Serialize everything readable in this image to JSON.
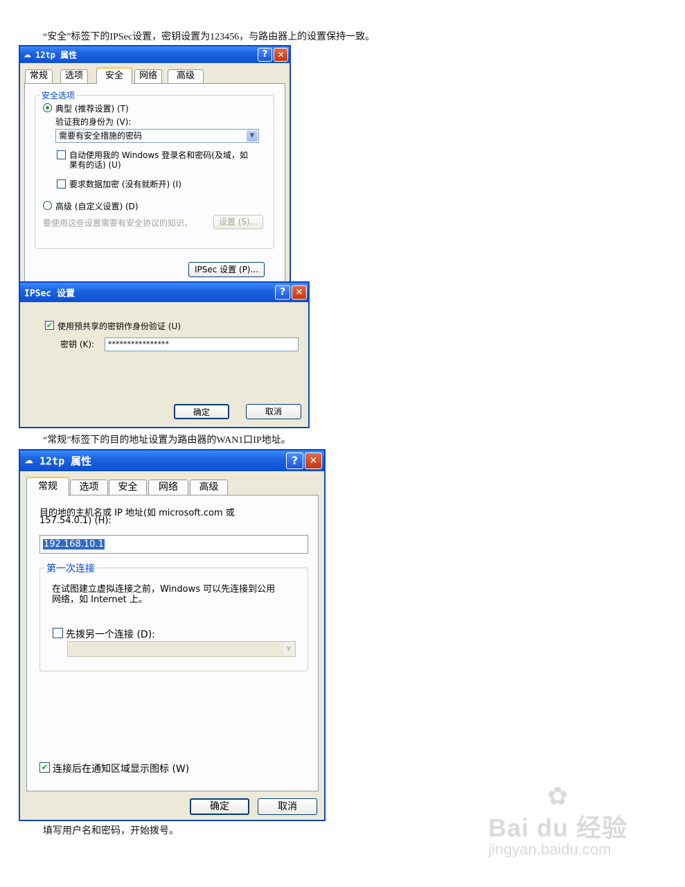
{
  "captions": {
    "c1": "“安全”标签下的IPSec设置，密钥设置为123456，与路由器上的设置保持一致。",
    "c2": "“常规”标签下的目的地址设置为路由器的WAN1口IP地址。",
    "c3": "填写用户名和密码，开始拨号。"
  },
  "dialog1": {
    "title": "12tp 属性",
    "help": "?",
    "close": "✕",
    "tabs": [
      "常规",
      "选项",
      "安全",
      "网络",
      "高级"
    ],
    "active_tab": "安全",
    "group_label": "安全选项",
    "radio_typical": "典型 (推荐设置) (T)",
    "verify_label": "验证我的身份为 (V):",
    "verify_value": "需要有安全措施的密码",
    "auto_logon": "自动使用我的 Windows 登录名和密码(及域，如",
    "auto_logon2": "果有的话) (U)",
    "require_encrypt": "要求数据加密 (没有就断开) (I)",
    "radio_advanced": "高级 (自定义设置) (D)",
    "advanced_hint": "要使用这些设置需要有安全协议的知识。",
    "settings_button": "设置 (S)...",
    "ipsec_button": "IPSec 设置 (P)..."
  },
  "dialog2": {
    "title": "IPSec 设置",
    "help": "?",
    "close": "✕",
    "psk_label": "使用预共享的密钥作身份验证 (U)",
    "key_label": "密钥 (K):",
    "key_value": "****************",
    "ok": "确定",
    "cancel": "取消"
  },
  "dialog3": {
    "title": "12tp 属性",
    "help": "?",
    "close": "✕",
    "tabs": [
      "常规",
      "选项",
      "安全",
      "网络",
      "高级"
    ],
    "active_tab": "常规",
    "host_label_1": "目的地的主机名或 IP 地址(如 microsoft.com 或",
    "host_label_2": "157.54.0.1) (H):",
    "host_value": "192.168.10.1",
    "group_label": "第一次连接",
    "first_text_1": "在试图建立虚拟连接之前，Windows 可以先连接到公用",
    "first_text_2": "网络，如 Internet 上。",
    "dial_first": "先拨另一个连接 (D):",
    "notify_icon": "连接后在通知区域显示图标 (W)",
    "ok": "确定",
    "cancel": "取消"
  },
  "watermark": {
    "brand": "Bai du 经验",
    "url": "jingyan.baidu.com"
  },
  "colors": {
    "titlebar": "#0c4fd1",
    "window_bg": "#ece9d8",
    "group_label": "#0046d5",
    "check_mark": "#21a121"
  }
}
